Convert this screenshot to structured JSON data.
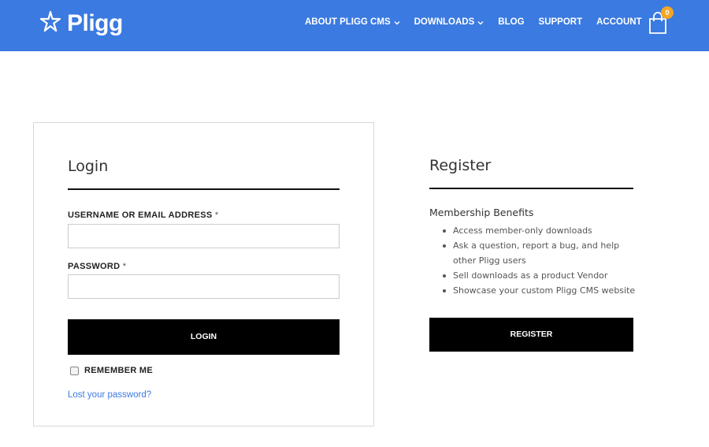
{
  "header": {
    "brand": "Pligg",
    "nav": [
      {
        "label": "ABOUT PLIGG CMS",
        "has_dropdown": true
      },
      {
        "label": "DOWNLOADS",
        "has_dropdown": true
      },
      {
        "label": "BLOG",
        "has_dropdown": false
      },
      {
        "label": "SUPPORT",
        "has_dropdown": false
      },
      {
        "label": "ACCOUNT",
        "has_dropdown": false
      }
    ],
    "cart_count": "0",
    "cart_icon": "shopping-bag-icon",
    "colors": {
      "bar": "#3b7ae0",
      "badge": "#f5a623"
    }
  },
  "login": {
    "title": "Login",
    "username_label": "USERNAME OR EMAIL ADDRESS",
    "password_label": "PASSWORD",
    "required_mark": "*",
    "username_value": "",
    "password_value": "",
    "submit_label": "LOGIN",
    "remember_label": "REMEMBER ME",
    "remember_checked": false,
    "lost_password_link": "Lost your password?"
  },
  "register": {
    "title": "Register",
    "benefits_title": "Membership Benefits",
    "benefits": [
      "Access member-only downloads",
      "Ask a question, report a bug, and help other Pligg users",
      "Sell downloads as a product Vendor",
      "Showcase your custom Pligg CMS website"
    ],
    "submit_label": "REGISTER"
  }
}
